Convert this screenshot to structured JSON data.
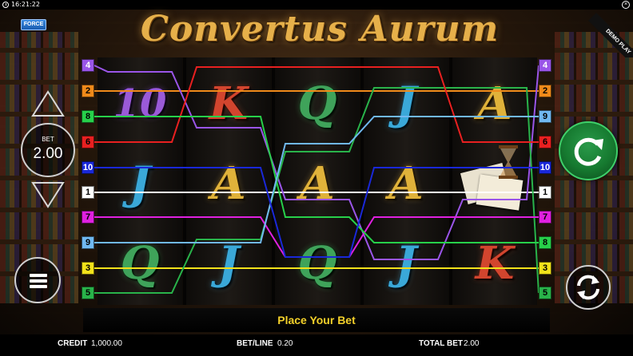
{
  "status_bar": {
    "time": "16:21:22"
  },
  "game": {
    "title": "Convertus Aurum",
    "force_label": "FORCE",
    "demo_label": "DEMO PLAY"
  },
  "reels": [
    [
      {
        "glyph": "10",
        "color": "purple"
      },
      {
        "glyph": "J",
        "color": "blue"
      },
      {
        "glyph": "Q",
        "color": "green"
      }
    ],
    [
      {
        "glyph": "K",
        "color": "red"
      },
      {
        "glyph": "A",
        "color": "gold"
      },
      {
        "glyph": "J",
        "color": "blue"
      }
    ],
    [
      {
        "glyph": "Q",
        "color": "green"
      },
      {
        "glyph": "A",
        "color": "gold"
      },
      {
        "glyph": "Q",
        "color": "green"
      }
    ],
    [
      {
        "glyph": "J",
        "color": "blue"
      },
      {
        "glyph": "A",
        "color": "gold"
      },
      {
        "glyph": "J",
        "color": "blue"
      }
    ],
    [
      {
        "glyph": "A",
        "color": "gold"
      },
      {
        "glyph": "scroll-hourglass-scatter",
        "color": "paper"
      },
      {
        "glyph": "K",
        "color": "red"
      }
    ]
  ],
  "paylines": [
    {
      "num": "1",
      "color": "#ffffff",
      "rows": [
        2,
        2,
        2,
        2,
        2
      ]
    },
    {
      "num": "2",
      "color": "#f08a1a",
      "rows": [
        0.5,
        0.5,
        0.5,
        0.5,
        0.5
      ]
    },
    {
      "num": "3",
      "color": "#f2e21a",
      "rows": [
        3.5,
        3.5,
        3.5,
        3.5,
        3.5
      ]
    },
    {
      "num": "4",
      "color": "#9a55e8",
      "rows": [
        0,
        0,
        1.8,
        3,
        3.5,
        0
      ]
    },
    {
      "num": "5",
      "color": "#29b34a",
      "rows": [
        4,
        3,
        1.5,
        0.5,
        4
      ]
    },
    {
      "num": "6",
      "color": "#e82020",
      "rows": [
        1,
        0,
        0,
        0,
        1
      ]
    },
    {
      "num": "7",
      "color": "#e020e0",
      "rows": [
        3,
        3,
        3,
        3,
        3
      ]
    },
    {
      "num": "8",
      "color": "#27d04a",
      "rows": [
        1,
        1,
        1,
        3,
        3
      ]
    },
    {
      "num": "9",
      "color": "#70b8f0",
      "rows": [
        3,
        3,
        3,
        1,
        1
      ]
    },
    {
      "num": "10",
      "color": "#1a28d8",
      "rows": [
        1.8,
        1.8,
        3.5,
        1.8,
        1.8
      ]
    }
  ],
  "left_markers": [
    "4",
    "2",
    "8",
    "6",
    "10",
    "1",
    "7",
    "9",
    "3",
    "5"
  ],
  "right_markers": [
    "4",
    "2",
    "9",
    "6",
    "10",
    "1",
    "7",
    "8",
    "3",
    "5"
  ],
  "controls": {
    "bet_label": "BET",
    "bet_value": "2.00"
  },
  "message": "Place Your Bet",
  "info": {
    "credit_label": "CREDIT",
    "credit_value": "1,000.00",
    "betline_label": "BET/LINE",
    "betline_value": "0.20",
    "totalbet_label": "TOTAL BET",
    "totalbet_value": "2.00"
  }
}
